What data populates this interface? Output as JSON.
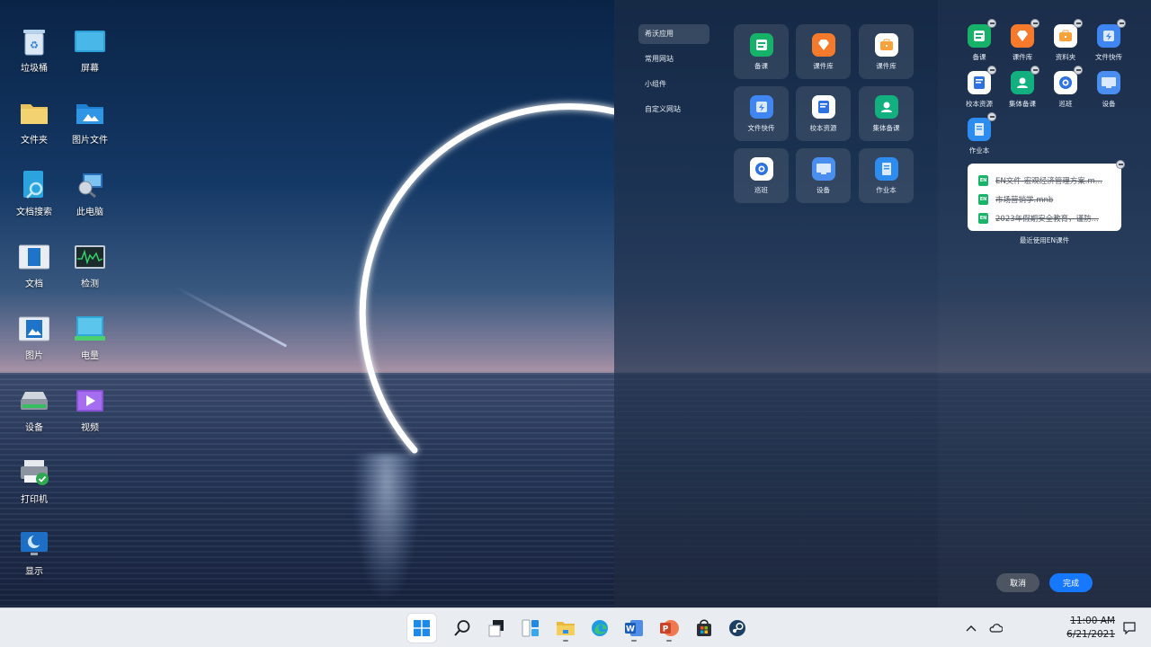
{
  "desktop": {
    "icons": [
      {
        "label": "垃圾桶",
        "icon": "recycle-bin-icon"
      },
      {
        "label": "屏幕",
        "icon": "screen-icon"
      },
      {
        "label": "文件夹",
        "icon": "folder-icon"
      },
      {
        "label": "图片文件",
        "icon": "picture-folder-icon"
      },
      {
        "label": "文档搜索",
        "icon": "document-search-icon"
      },
      {
        "label": "此电脑",
        "icon": "this-pc-icon"
      },
      {
        "label": "文档",
        "icon": "document-icon"
      },
      {
        "label": "检测",
        "icon": "monitor-icon"
      },
      {
        "label": "图片",
        "icon": "picture-icon"
      },
      {
        "label": "电量",
        "icon": "battery-icon"
      },
      {
        "label": "设备",
        "icon": "device-icon"
      },
      {
        "label": "视频",
        "icon": "video-icon"
      },
      {
        "label": "打印机",
        "icon": "printer-icon"
      },
      {
        "label": "显示",
        "icon": "display-icon"
      }
    ]
  },
  "panel": {
    "categories": [
      "希沃应用",
      "常用网站",
      "小组件",
      "自定义网站"
    ],
    "active_category": "希沃应用",
    "apps": [
      {
        "label": "备课",
        "color": "#17b26a"
      },
      {
        "label": "课件库",
        "color": "#f57a2c"
      },
      {
        "label": "课件库",
        "color": "#ffffff"
      },
      {
        "label": "文件快传",
        "color": "#3f86f2"
      },
      {
        "label": "校本资源",
        "color": "#ffffff"
      },
      {
        "label": "集体备课",
        "color": "#12b07e"
      },
      {
        "label": "巡班",
        "color": "#ffffff"
      },
      {
        "label": "设备",
        "color": "#4a8ff0"
      },
      {
        "label": "作业本",
        "color": "#2d8cf0"
      }
    ],
    "pinned": [
      {
        "label": "备课",
        "color": "#17b26a"
      },
      {
        "label": "课件库",
        "color": "#f57a2c"
      },
      {
        "label": "资料夹",
        "color": "#ffffff"
      },
      {
        "label": "文件快传",
        "color": "#3f86f2"
      },
      {
        "label": "校本资源",
        "color": "#ffffff"
      },
      {
        "label": "集体备课",
        "color": "#12b07e"
      },
      {
        "label": "巡班",
        "color": "#ffffff"
      },
      {
        "label": "设备",
        "color": "#4a8ff0"
      },
      {
        "label": "作业本",
        "color": "#2d8cf0"
      }
    ],
    "recent_widget": {
      "badge": "EN",
      "files": [
        "EN文件-宏观经济管理方案.m...",
        "市场营销学.mnb",
        "2023年假期安全教育，谨防..."
      ],
      "caption": "最近使用EN课件"
    },
    "cancel_label": "取消",
    "done_label": "完成"
  },
  "taskbar": {
    "apps": [
      "start-icon",
      "search-icon",
      "task-view-icon",
      "widgets-icon",
      "file-explorer-icon",
      "edge-icon",
      "word-icon",
      "powerpoint-icon",
      "store-icon",
      "steam-icon"
    ],
    "time": "11:00 AM",
    "date": "6/21/2021"
  }
}
